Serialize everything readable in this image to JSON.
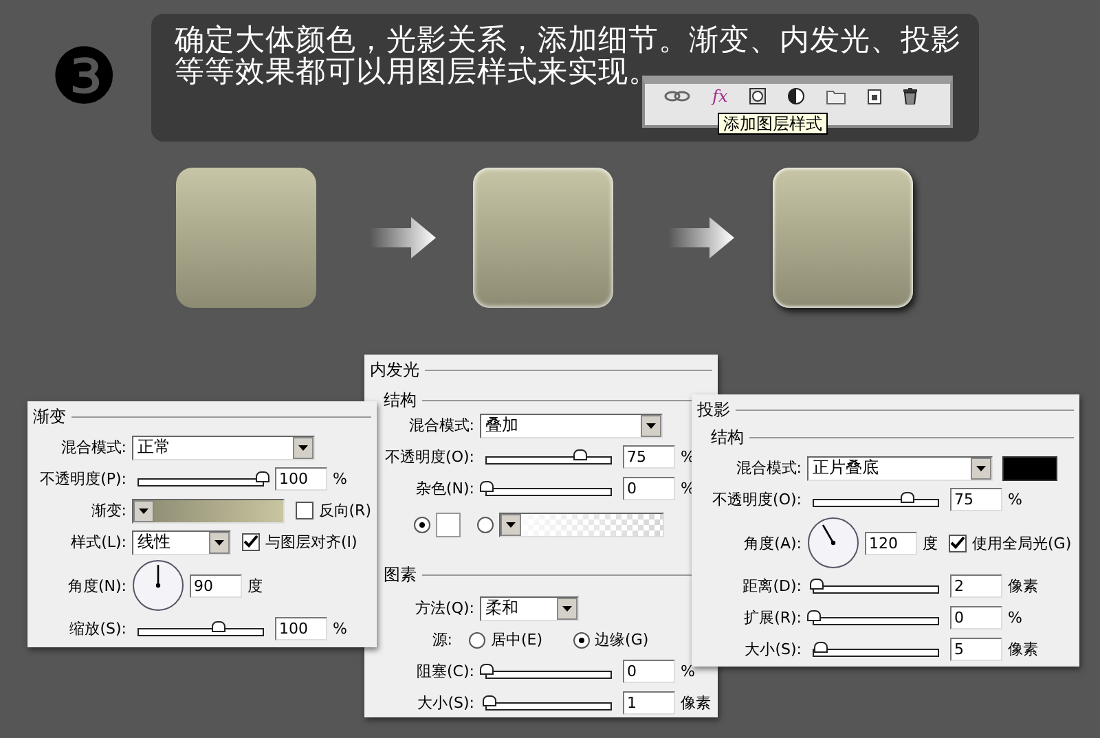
{
  "header": {
    "step_badge": "❸",
    "caption": "确定大体颜色，光影关系，添加细节。渐变、内发光、投影等等效果都可以用图层样式来实现。",
    "layers_toolbar": {
      "fx": "fx",
      "tooltip": "添加图层样式"
    }
  },
  "steps": [
    {
      "kind": "gradient"
    },
    {
      "kind": "inner_glow"
    },
    {
      "kind": "drop_shadow"
    }
  ],
  "panels": [
    {
      "title": "渐变",
      "sections": [
        {
          "rows": [
            {
              "kind": "blend_mode",
              "label": "混合模式:",
              "value": "正常"
            },
            {
              "kind": "slider",
              "label": "不透明度(P):",
              "level": 1,
              "value": "100",
              "unit": "%"
            },
            {
              "kind": "gradient",
              "label": "渐变:",
              "checkbox": {
                "label": "反向(R)",
                "checked": false
              }
            },
            {
              "kind": "option",
              "label": "样式(L):",
              "value": "线性",
              "checkbox": {
                "label": "与图层对齐(I)",
                "checked": true
              }
            },
            {
              "kind": "angle",
              "label": "角度(N):",
              "value": "90",
              "unit": "度"
            },
            {
              "kind": "slider",
              "label": "缩放(S):",
              "level": 0.64,
              "value": "100",
              "unit": "%"
            }
          ]
        }
      ]
    },
    {
      "title": "内发光",
      "sections": [
        {
          "title": "结构",
          "rows": [
            {
              "kind": "blend_mode",
              "label": "混合模式:",
              "value": "叠加"
            },
            {
              "kind": "slider",
              "label": "不透明度(O):",
              "level": 0.75,
              "value": "75",
              "unit": "%"
            },
            {
              "kind": "slider",
              "label": "杂色(N):",
              "level": 0,
              "value": "0",
              "unit": "%"
            },
            {
              "kind": "fill",
              "options": [
                {
                  "kind": "color",
                  "selected": true,
                  "color": "#ffffff"
                },
                {
                  "kind": "gradient",
                  "selected": false
                }
              ]
            }
          ]
        },
        {
          "title": "图素",
          "rows": [
            {
              "kind": "option",
              "label": "方法(Q):",
              "value": "柔和"
            },
            {
              "kind": "source",
              "label": "源:",
              "options": [
                {
                  "label": "居中(E)",
                  "selected": false
                },
                {
                  "label": "边缘(G)",
                  "selected": true
                }
              ]
            },
            {
              "kind": "slider",
              "label": "阻塞(C):",
              "level": 0,
              "value": "0",
              "unit": "%"
            },
            {
              "kind": "slider",
              "label": "大小(S):",
              "level": 0.02,
              "value": "1",
              "unit": "像素"
            }
          ]
        }
      ]
    },
    {
      "title": "投影",
      "sections": [
        {
          "title": "结构",
          "rows": [
            {
              "kind": "blend_mode",
              "label": "混合模式:",
              "value": "正片叠底",
              "color": "#000000"
            },
            {
              "kind": "slider",
              "label": "不透明度(O):",
              "level": 0.75,
              "value": "75",
              "unit": "%"
            },
            {
              "kind": "angle",
              "label": "角度(A):",
              "value": "120",
              "unit": "度",
              "checkbox": {
                "label": "使用全局光(G)",
                "checked": true
              }
            },
            {
              "kind": "slider",
              "label": "距离(D):",
              "level": 0.02,
              "value": "2",
              "unit": "像素"
            },
            {
              "kind": "slider",
              "label": "扩展(R):",
              "level": 0,
              "value": "0",
              "unit": "%"
            },
            {
              "kind": "slider",
              "label": "大小(S):",
              "level": 0.05,
              "value": "5",
              "unit": "像素"
            }
          ]
        }
      ]
    }
  ]
}
